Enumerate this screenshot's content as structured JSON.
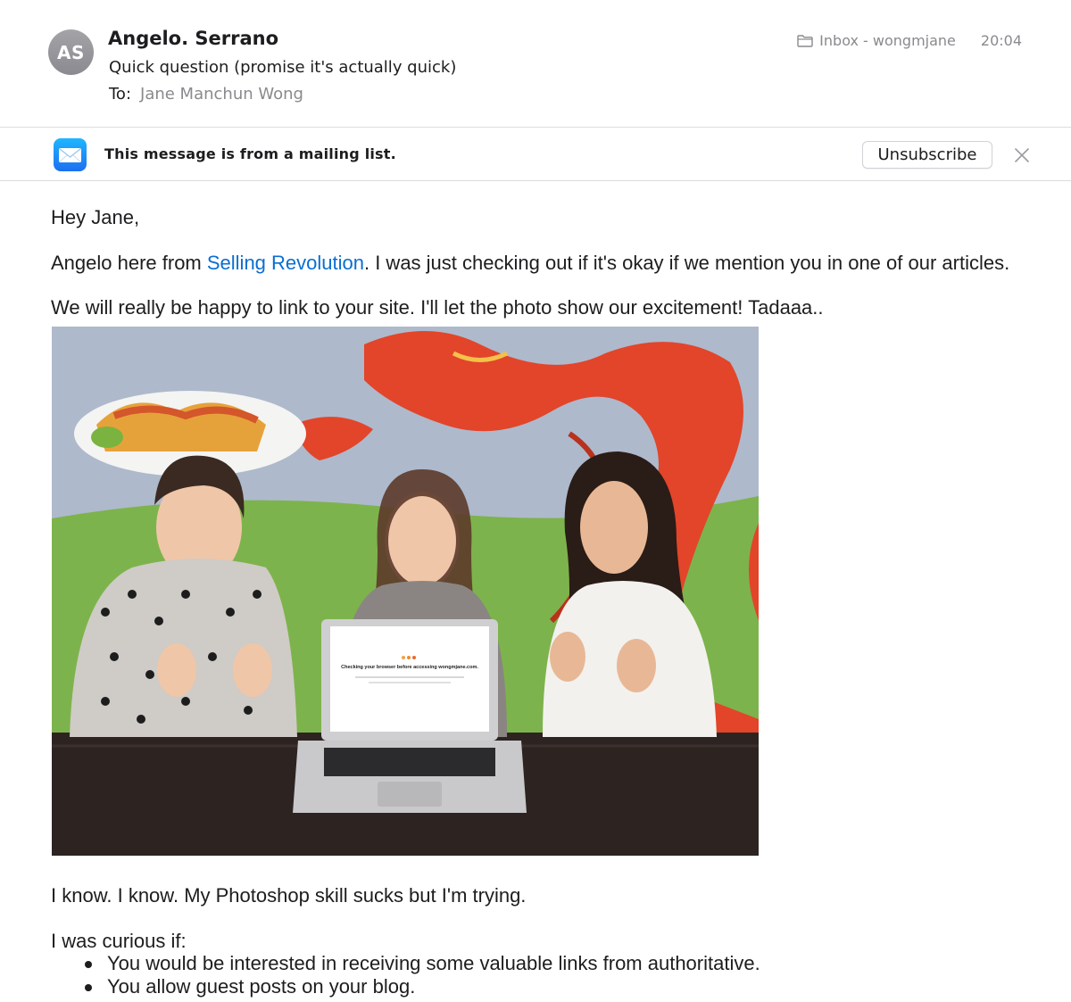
{
  "header": {
    "avatar_initials": "AS",
    "sender": "Angelo. Serrano",
    "subject": "Quick question (promise it's actually quick)",
    "to_label": "To:",
    "to_value": "Jane Manchun Wong",
    "mailbox": "Inbox - wongmjane",
    "time": "20:04"
  },
  "banner": {
    "message": "This message is from a mailing list.",
    "unsubscribe_label": "Unsubscribe"
  },
  "body": {
    "greeting": "Hey Jane,",
    "line2_before": "Angelo here from ",
    "line2_link": "Selling Revolution",
    "line2_after": ". I was just checking out if it's okay if we mention you in one of our articles.",
    "line3": "We will really be happy to link to your site. I'll let the photo show our excitement! Tadaaa..",
    "laptop_screen_title": "Checking your browser before accessing wongmjane.com.",
    "after_photo": "I know. I know. My Photoshop skill sucks but I'm trying.",
    "curious": "I was curious if:",
    "bullets": [
      "You would be interested in receiving some valuable links from authoritative.",
      "You allow guest posts on your blog."
    ]
  },
  "colors": {
    "link": "#0a6ed1",
    "avatar": "#9a9aa0",
    "wall_green": "#7bb24a",
    "dragon_red": "#e2452a"
  }
}
